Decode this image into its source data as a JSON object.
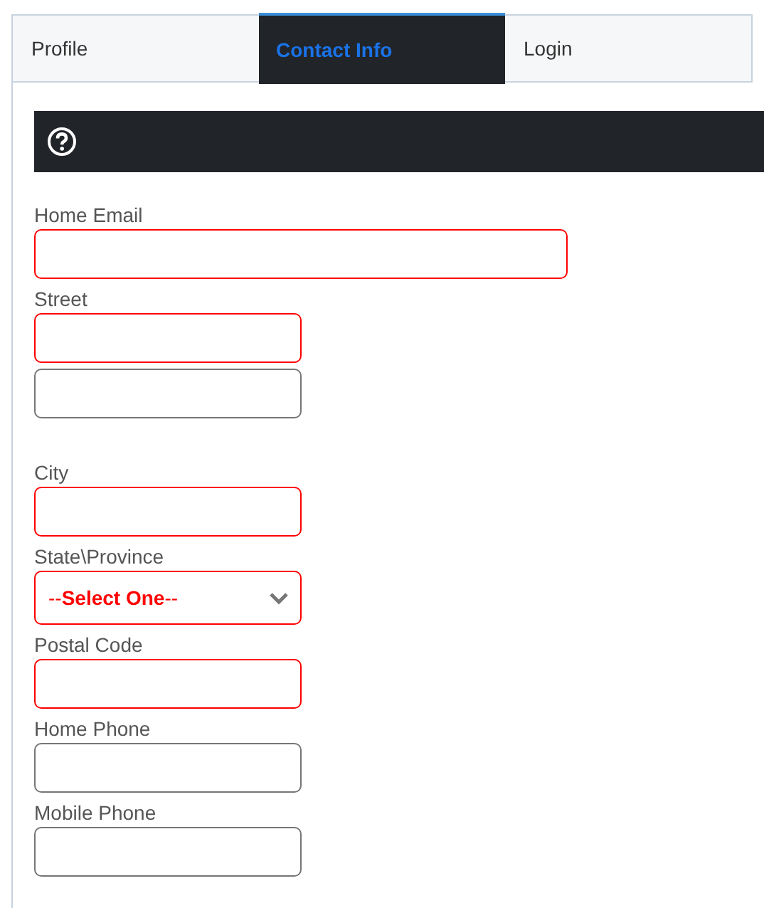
{
  "tabs": [
    {
      "label": "Profile",
      "selected": false
    },
    {
      "label": "Contact Info",
      "selected": true
    },
    {
      "label": "Login",
      "selected": false
    }
  ],
  "fields": [
    {
      "label": "Home Email",
      "kind": "text",
      "required": true,
      "wide": true
    },
    {
      "label": "Street",
      "kind": "text",
      "required": true,
      "wide": false
    },
    {
      "kind": "text",
      "required": false,
      "wide": false
    },
    {
      "label": "City",
      "kind": "text",
      "required": true,
      "wide": false
    },
    {
      "label": "State\\Province",
      "kind": "select",
      "required": true,
      "wide": false,
      "value": "--**Select One**--"
    },
    {
      "label": "Postal Code",
      "kind": "text",
      "required": true,
      "wide": false
    },
    {
      "label": "Home Phone",
      "kind": "text",
      "required": false,
      "wide": false
    },
    {
      "label": "Mobile Phone",
      "kind": "text",
      "required": false,
      "wide": false
    }
  ]
}
